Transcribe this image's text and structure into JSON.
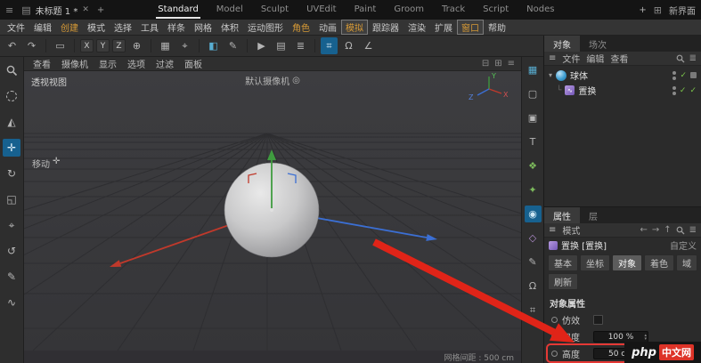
{
  "titlebar": {
    "doc_tab": "未标题 1 *",
    "layouts": [
      "Standard",
      "Model",
      "Sculpt",
      "UVEdit",
      "Paint",
      "Groom",
      "Track",
      "Script",
      "Nodes"
    ],
    "new_layout": "新界面"
  },
  "menubar": {
    "items": [
      {
        "label": "文件"
      },
      {
        "label": "编辑"
      },
      {
        "label": "创建"
      },
      {
        "label": "模式"
      },
      {
        "label": "选择"
      },
      {
        "label": "工具"
      },
      {
        "label": "样条"
      },
      {
        "label": "网格"
      },
      {
        "label": "体积"
      },
      {
        "label": "运动图形"
      },
      {
        "label": "角色"
      },
      {
        "label": "动画"
      },
      {
        "label": "模拟"
      },
      {
        "label": "跟踪器"
      },
      {
        "label": "渲染"
      },
      {
        "label": "扩展"
      },
      {
        "label": "窗口"
      },
      {
        "label": "帮助"
      }
    ]
  },
  "toolbar": {
    "axis_x": "X",
    "axis_y": "Y",
    "axis_z": "Z"
  },
  "viewport": {
    "menu": [
      "查看",
      "摄像机",
      "显示",
      "选项",
      "过滤",
      "面板"
    ],
    "view_label": "透视视图",
    "camera_label": "默认摄像机",
    "tool_label": "移动",
    "grid_status": "网格间距 : 500 cm",
    "axis_x": "X",
    "axis_y": "Y",
    "axis_z": "Z"
  },
  "objects_panel": {
    "tab_objects": "对象",
    "tab_takes": "场次",
    "menu": [
      "文件",
      "编辑",
      "查看"
    ],
    "rows": [
      {
        "label": "球体"
      },
      {
        "label": "置换"
      }
    ]
  },
  "attributes_panel": {
    "tab_attributes": "属性",
    "tab_layers": "层",
    "mode_label": "模式",
    "title": "置换 [置换]",
    "custom_label": "自定义",
    "tabs": [
      "基本",
      "坐标",
      "对象",
      "着色",
      "域"
    ],
    "refresh_tab": "刷新",
    "section_title": "对象属性",
    "falloff_label": "仿效",
    "strength_label": "强度",
    "strength_value": "100 %",
    "height_label": "高度",
    "height_value": "50 cm"
  },
  "watermark": {
    "left": "php",
    "right": "中文网"
  },
  "colors": {
    "accent_orange": "#d79a36",
    "active_blue": "#17618f",
    "annotation_red": "#e02418",
    "check_green": "#7ac24a"
  },
  "icons": {
    "app_menu": "≡",
    "doc": "▤",
    "close": "✕",
    "plus": "+",
    "window": "⊞",
    "undo": "↶",
    "redo": "↷",
    "marquee": "▭",
    "modeling_axis": "⌖",
    "coord_system": "⊕",
    "workplane": "▦",
    "solo": "◧",
    "paint": "✎",
    "render_view": "▶",
    "render_picture": "▤",
    "render_settings": "≣",
    "grid_snap": "⌗",
    "magnet": "Ω",
    "angle_snap": "∠",
    "move": "✛",
    "rotate": "↻",
    "scale": "◱",
    "axis_tool": "⌖",
    "view_undo": "↺",
    "sculpt": "◭",
    "pen": "✎",
    "wave": "∿",
    "strip_layout": "▦",
    "strip_square": "▢",
    "strip_cube": "▣",
    "strip_text": "T",
    "strip_mograph": "❖",
    "strip_dynamics": "✦",
    "strip_deformer": "◉",
    "strip_field": "◇",
    "strip_pen": "✎",
    "strip_magnet": "Ω",
    "strip_grid": "⌗",
    "vp_min": "⊟",
    "vp_max": "⊞",
    "vp_menu": "≡",
    "camera_target": "◎",
    "burger": "≡",
    "filter": "≣",
    "arrow_left": "←",
    "arrow_right": "→",
    "arrow_up": "↑",
    "check": "✓",
    "expand": "▾",
    "branch": "└",
    "spin_up": "▴",
    "spin_down": "▾"
  }
}
